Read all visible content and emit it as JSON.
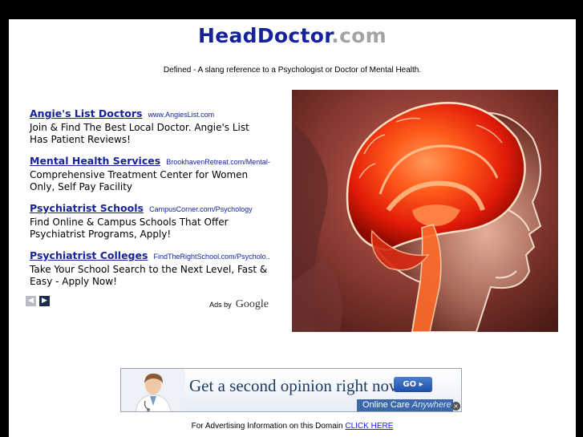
{
  "header": {
    "site_name": "HeadDoctor",
    "site_tld": ".com",
    "tagline": "Defined - A slang reference to a Psychologist or Doctor of Mental Health."
  },
  "ads": {
    "items": [
      {
        "title": "Angie's List Doctors",
        "url": "www.AngiesList.com",
        "text": "Join & Find The Best Local Doctor. Angie's List Has Patient Reviews!"
      },
      {
        "title": "Mental Health Services",
        "url": "BrookhavenRetreat.com/Mental-...",
        "text": "Comprehensive Treatment Center for Women Only, Self Pay Facility"
      },
      {
        "title": "Psychiatrist Schools",
        "url": "CampusCorner.com/Psychology",
        "text": "Find Online & Campus Schools That Offer Psychiatrist Programs, Apply!"
      },
      {
        "title": "Psychiatrist Colleges",
        "url": "FindTheRightSchool.com/Psycholo...",
        "text": "Take Your School Search to the Next Level, Fast & Easy - Apply Now!"
      }
    ],
    "prev_icon": "chevron-left-icon",
    "next_icon": "chevron-right-icon",
    "prev_glyph": "◀",
    "next_glyph": "▶",
    "ads_by_label": "Ads by",
    "ads_by_brand": "Google"
  },
  "banner": {
    "headline": "Get a second opinion right now",
    "go_label": "GO ▸",
    "brand_primary": "Online Care ",
    "brand_secondary": "Anywhere",
    "close_glyph": "×"
  },
  "footer": {
    "advert_text": "For Advertising Information on this Domain",
    "advert_link": "CLICK HERE"
  },
  "colors": {
    "title_blue": "#16229a",
    "title_gray": "#a4a4a4",
    "link_blue": "#1a1aff",
    "page_bg": "#ffffff",
    "frame_bg": "#000000"
  }
}
